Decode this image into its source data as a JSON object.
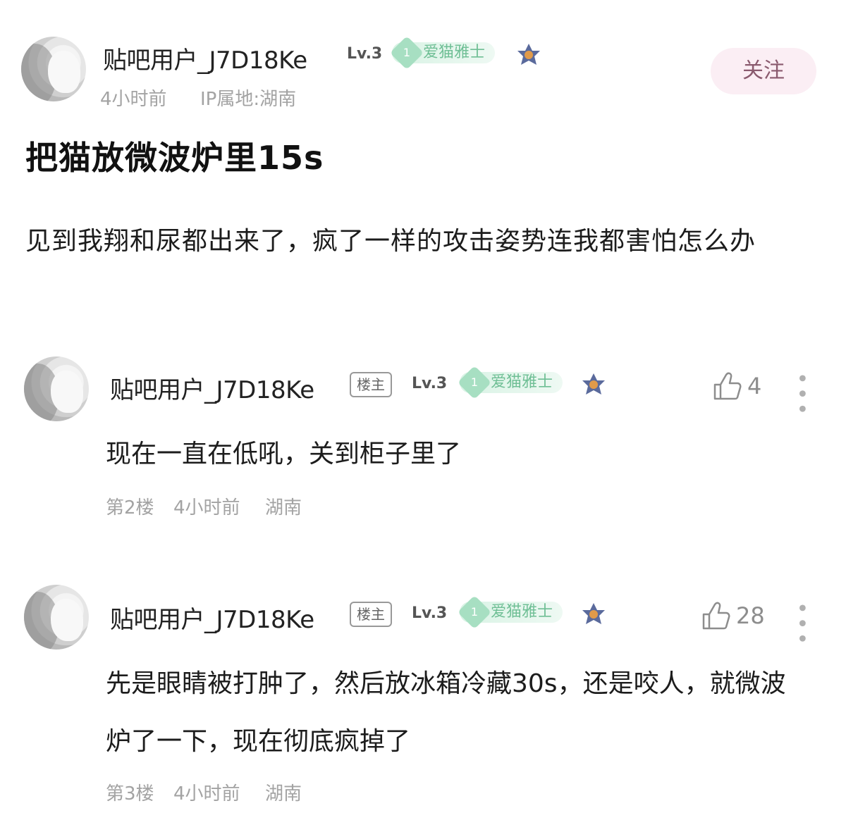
{
  "post": {
    "author": "贴吧用户_J7D18Ke",
    "level": "Lv.3",
    "fan_badge": "爱猫雅士",
    "fan_level": "1",
    "time": "4小时前",
    "ip": "IP属地:湖南",
    "follow_label": "关注",
    "title": "把猫放微波炉里15s",
    "body": "见到我翔和尿都出来了，疯了一样的攻击姿势连我都害怕怎么办"
  },
  "replies": [
    {
      "author": "贴吧用户_J7D18Ke",
      "op_tag": "楼主",
      "level": "Lv.3",
      "fan_badge": "爱猫雅士",
      "fan_level": "1",
      "likes": "4",
      "text": "现在一直在低吼，关到柜子里了",
      "floor": "第2楼",
      "time": "4小时前",
      "location": "湖南"
    },
    {
      "author": "贴吧用户_J7D18Ke",
      "op_tag": "楼主",
      "level": "Lv.3",
      "fan_badge": "爱猫雅士",
      "fan_level": "1",
      "likes": "28",
      "text": "先是眼睛被打肿了，然后放冰箱冷藏30s，还是咬人，就微波炉了一下，现在彻底疯掉了",
      "floor": "第3楼",
      "time": "4小时前",
      "location": "湖南"
    }
  ],
  "icons": {
    "like": "thumbs-up-icon",
    "more": "more-vertical-icon",
    "badge": "crown-badge-icon",
    "gem": "gem-icon"
  },
  "colors": {
    "follow_bg": "#fbeef4",
    "fan_badge_text": "#6fbf95",
    "meta_text": "#a3a3a3"
  }
}
